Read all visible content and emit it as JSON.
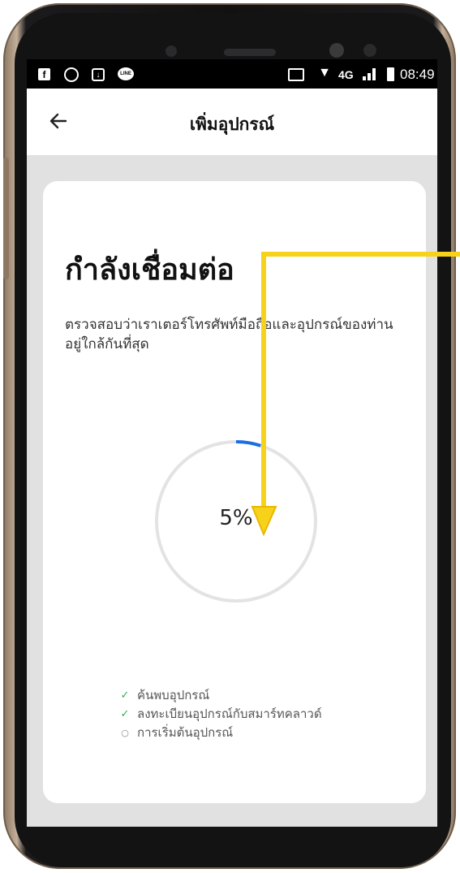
{
  "status_bar": {
    "left_icons": [
      "facebook-icon",
      "aperture-icon",
      "download-icon",
      "line-icon"
    ],
    "fb_glyph": "f",
    "line_glyph": "LINE",
    "network": "4G",
    "time": "08:49"
  },
  "app_bar": {
    "back_icon": "arrow-left-icon",
    "title": "เพิ่มอุปกรณ์"
  },
  "card": {
    "title": "กำลังเชื่อมต่อ",
    "description": "ตรวจสอบว่าเราเตอร์โทรศัพท์มือถือและอุปกรณ์ของท่านอยู่ใกล้กันที่สุด",
    "progress": {
      "percent": 5,
      "label": "5%",
      "track_color": "#e3e3e3",
      "fill_color": "#1a6fe0"
    },
    "steps": [
      {
        "label": "ค้นพบอุปกรณ์",
        "state": "done",
        "glyph": "✓"
      },
      {
        "label": "ลงทะเบียนอุปกรณ์กับสมาร์ทคลาวด์",
        "state": "done",
        "glyph": "✓"
      },
      {
        "label": "การเริ่มต้นอุปกรณ์",
        "state": "pending",
        "glyph": "○"
      }
    ]
  },
  "colors": {
    "screen_background": "#e1e1e1",
    "card_background": "#ffffff",
    "annotation_arrow": "#f6d21a",
    "step_done": "#2cb34a"
  }
}
